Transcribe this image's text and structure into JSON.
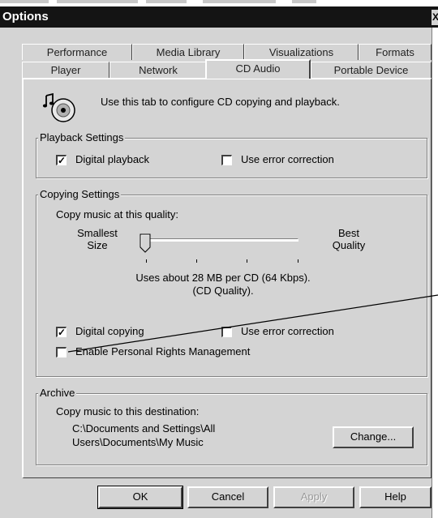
{
  "window": {
    "title": "Options",
    "close_glyph": "X"
  },
  "tabs_row_back": [
    {
      "label": "Performance"
    },
    {
      "label": "Media Library"
    },
    {
      "label": "Visualizations"
    },
    {
      "label": "Formats"
    }
  ],
  "tabs_row_front": [
    {
      "label": "Player"
    },
    {
      "label": "Network"
    },
    {
      "label": "CD Audio",
      "active": true
    },
    {
      "label": "Portable Device"
    }
  ],
  "intro": {
    "icon": "cd-audio-icon",
    "text": "Use this tab to configure CD copying and playback."
  },
  "playback_settings": {
    "legend": "Playback Settings",
    "digital_playback": {
      "label": "Digital playback",
      "checked": true,
      "mark": "✓"
    },
    "error_correction": {
      "label": "Use error correction",
      "checked": false
    }
  },
  "copying_settings": {
    "legend": "Copying Settings",
    "quality_label": "Copy music at this quality:",
    "slider": {
      "min_label_1": "Smallest",
      "min_label_2": "Size",
      "max_label_1": "Best",
      "max_label_2": "Quality",
      "level": 0,
      "tick_count": 4
    },
    "usage_line_1": "Uses about 28 MB per CD (64 Kbps).",
    "usage_line_2": "(CD Quality).",
    "digital_copying": {
      "label": "Digital copying",
      "checked": true,
      "mark": "✓"
    },
    "copy_error_correction": {
      "label": "Use error correction",
      "checked": false
    },
    "prm": {
      "label": "Enable Personal Rights Management",
      "checked": false
    }
  },
  "archive": {
    "legend": "Archive",
    "destination_label": "Copy music to this destination:",
    "path_line_1": "C:\\Documents and Settings\\All",
    "path_line_2": "Users\\Documents\\My Music",
    "change_button": "Change..."
  },
  "buttons": {
    "ok": "OK",
    "cancel": "Cancel",
    "apply": "Apply",
    "help": "Help"
  },
  "colors": {
    "dialog_face": "#d4d4d4",
    "titlebar": "#141414",
    "disabled_text": "#9a9a9a"
  }
}
